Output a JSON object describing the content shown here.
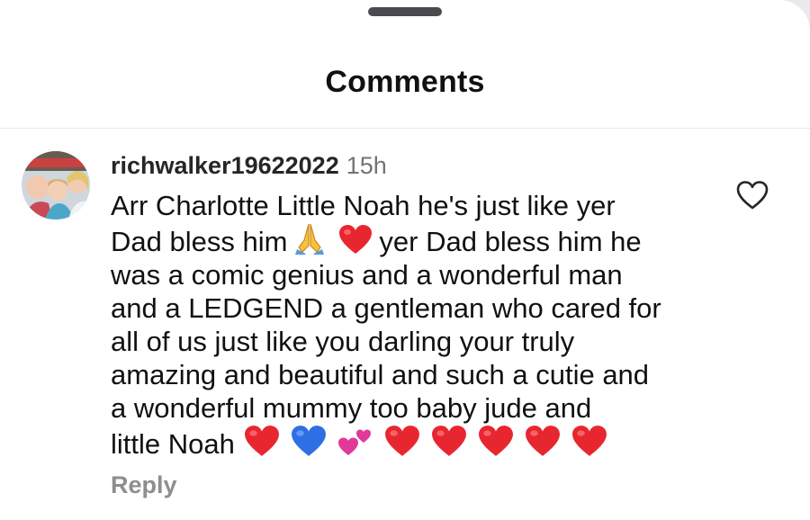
{
  "header": {
    "title": "Comments"
  },
  "comment": {
    "username": "richwalker19622022",
    "timestamp": "15h",
    "avatar_alt": "profile-photo-avatar",
    "lines": [
      "Arr Charlotte Little Noah he's just like yer",
      "Dad bless him",
      "yer Dad bless him he",
      "was a comic genius and a wonderful man",
      "and a LEDGEND a gentleman who cared for",
      "all of us  just like you darling your truly",
      "amazing and beautiful and such a cutie and",
      "a wonderful mummy too baby jude and",
      "little Noah"
    ],
    "emojis": {
      "line2": [
        "folded-hands",
        "red-heart"
      ],
      "line9": [
        "red-heart",
        "blue-heart",
        "two-hearts",
        "red-heart",
        "red-heart",
        "red-heart",
        "red-heart",
        "red-heart"
      ]
    },
    "reply_label": "Reply",
    "like_icon": "heart-outline-icon"
  },
  "colors": {
    "red_heart": "#e8262f",
    "blue_heart": "#2f6fe4",
    "pink_heart": "#e2389a",
    "timestamp": "#737373",
    "reply": "#8e8e8e"
  }
}
